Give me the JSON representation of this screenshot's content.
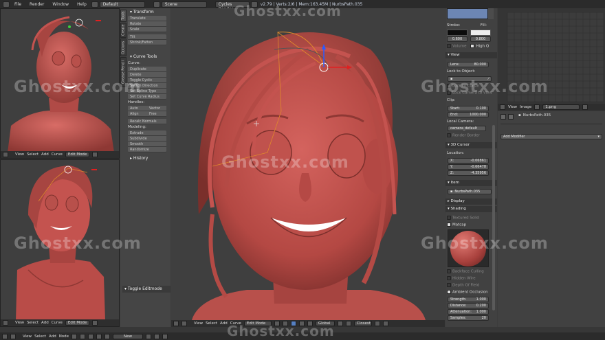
{
  "menubar": {
    "items": [
      "File",
      "Render",
      "Window",
      "Help"
    ],
    "layout": "Default",
    "scene": "Scene",
    "engine": "Cycles Render",
    "stats": "v2.79 | Verts:2/6 | Mem:163.45M | NurbsPath.035"
  },
  "watermark": "Ghostxx.com",
  "viewport_tl": {
    "header": [
      "View",
      "Select",
      "Add",
      "Curve"
    ],
    "mode": "Edit Mode"
  },
  "viewport_bl": {
    "header": [
      "View",
      "Select",
      "Add",
      "Curve"
    ],
    "mode": "Edit Mode"
  },
  "tool_shelf": {
    "tabs": [
      "Tools",
      "Create",
      "Options",
      "Grease Pencil"
    ],
    "transform_title": "Transform",
    "transform": [
      "Translate",
      "Rotate",
      "Scale",
      "Tilt",
      "Shrink/Fatten"
    ],
    "curve_tools_title": "Curve Tools",
    "curve_label": "Curve:",
    "curve": [
      "Duplicate",
      "Delete",
      "Toggle Cyclic",
      "Switch Direction",
      "Set Spline Type",
      "Set Curve Radius"
    ],
    "handles_label": "Handles:",
    "handles": [
      "Auto",
      "Vector",
      "Align",
      "Free"
    ],
    "recalc": "Recalc Normals",
    "modeling_label": "Modeling:",
    "modeling": [
      "Extrude",
      "Subdivide",
      "Smooth",
      "Randomize"
    ],
    "history": "History",
    "toggle_editmode": "Toggle Editmode"
  },
  "main_viewport": {
    "header": [
      "View",
      "Select",
      "Add",
      "Curve"
    ],
    "mode": "Edit Mode",
    "orientation": "Global",
    "pivot": "Closest"
  },
  "properties": {
    "stroke_label": "Stroke:",
    "fill_label": "Fill:",
    "stroke_value": "0.600",
    "fill_value": "0.800",
    "volume": "Volume",
    "high_q": "High Q",
    "view_title": "View",
    "lens_label": "Lens:",
    "lens_value": "80.000",
    "lock_label": "Lock to Object:",
    "lock_cursor": "Lock to Cursor",
    "lock_camera": "Lock Camera to View",
    "clip_label": "Clip:",
    "clip_start_label": "Start:",
    "clip_start": "0.100",
    "clip_end_label": "End:",
    "clip_end": "1000.000",
    "local_camera": "Local Camera:",
    "camera_default": "camera_default",
    "render_border": "Render Border",
    "cursor_title": "3D Cursor",
    "location_label": "Location:",
    "x_label": "X:",
    "x": "-0.06861",
    "y_label": "Y:",
    "y": "-0.66478",
    "z_label": "Z:",
    "z": "-4.35956",
    "item_title": "Item",
    "item_name": "NurbsPath.035",
    "display_title": "Display",
    "shading_title": "Shading",
    "textured_solid": "Textured Solid",
    "matcap": "Matcap",
    "backface": "Backface Culling",
    "hidden_wire": "Hidden Wire",
    "depth_of_field": "Depth Of Field",
    "ambient_occlusion": "Ambient Occlusion",
    "strength_label": "Strength:",
    "strength": "1.000",
    "distance_label": "Distance:",
    "distance": "0.200",
    "attenuation_label": "Attenuation:",
    "attenuation": "1.000",
    "samples_label": "Samples:",
    "samples": "20"
  },
  "right_panel": {
    "header": [
      "View",
      "Image"
    ],
    "image_name": "1.png",
    "object_name": "NurbsPath.035",
    "add_modifier": "Add Modifier"
  },
  "bottom_bar": {
    "items": [
      "View",
      "Select",
      "Add",
      "Node"
    ],
    "new_label": "New"
  },
  "colors": {
    "skin": "#c4534f",
    "bg": "#3f3f3f",
    "accent": "#5680c2",
    "curve": "#e08a2c"
  }
}
